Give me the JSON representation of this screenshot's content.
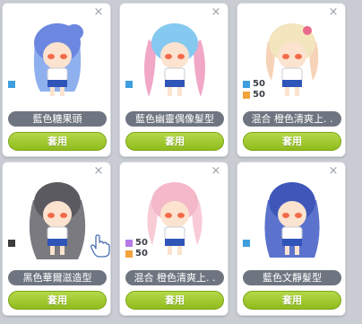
{
  "close_glyph": "×",
  "cards": [
    {
      "name": "藍色糖果頭",
      "button": "套用",
      "hair": "#6b87e0",
      "hair2": "#8fb0ee",
      "swatches": [
        {
          "color": "#3f9ee0",
          "pct": ""
        }
      ]
    },
    {
      "name": "藍色幽靈偶像髮型",
      "button": "套用",
      "hair": "#86c9f0",
      "hair2": "#f1a7c6",
      "swatches": [
        {
          "color": "#3f9ee0",
          "pct": ""
        }
      ]
    },
    {
      "name": "混合 橙色清爽上. .",
      "button": "套用",
      "hair": "#f3e6bf",
      "hair2": "#f6d3b8",
      "swatches": [
        {
          "color": "#3f9ee0",
          "pct": "50"
        },
        {
          "color": "#f2a33a",
          "pct": "50"
        }
      ]
    },
    {
      "name": "黑色華爾滋造型",
      "button": "套用",
      "hair": "#5a5a60",
      "hair2": "#7a7a80",
      "swatches": [
        {
          "color": "#3d3d3d",
          "pct": ""
        }
      ]
    },
    {
      "name": "混合 橙色清爽上. .",
      "button": "套用",
      "hair": "#f4b8c8",
      "hair2": "#f8cbd6",
      "swatches": [
        {
          "color": "#b57be6",
          "pct": "50"
        },
        {
          "color": "#f2a33a",
          "pct": "50"
        }
      ]
    },
    {
      "name": "藍色文靜髮型",
      "button": "套用",
      "hair": "#3f57b8",
      "hair2": "#5b73cc",
      "swatches": [
        {
          "color": "#3f9ee0",
          "pct": ""
        }
      ]
    }
  ]
}
